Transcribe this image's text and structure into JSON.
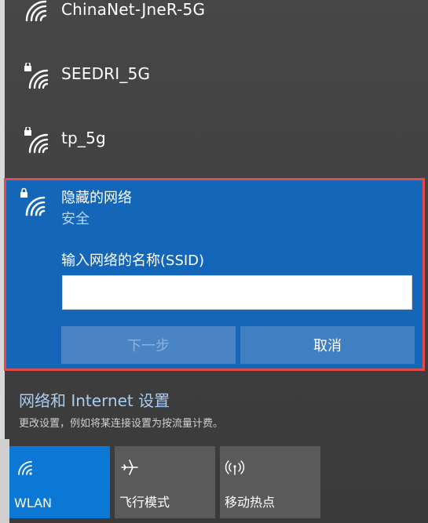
{
  "networks": [
    {
      "name": "ChinaNet-JneR-5G",
      "secured": false
    },
    {
      "name": "SEEDRI_5G",
      "secured": true
    },
    {
      "name": "tp_5g",
      "secured": true
    }
  ],
  "hidden_network": {
    "title": "隐藏的网络",
    "subtitle": "安全",
    "ssid_label": "输入网络的名称(SSID)",
    "ssid_value": "",
    "next_label": "下一步",
    "cancel_label": "取消"
  },
  "settings": {
    "link": "网络和 Internet 设置",
    "description": "更改设置，例如将某连接设置为按流量计费。"
  },
  "quick_actions": [
    {
      "label": "WLAN",
      "icon": "wifi-icon",
      "active": true
    },
    {
      "label": "飞行模式",
      "icon": "airplane-icon",
      "active": false
    },
    {
      "label": "移动热点",
      "icon": "hotspot-icon",
      "active": false
    }
  ],
  "colors": {
    "accent": "#1366b8",
    "highlight_border": "#e24b4b",
    "link": "#a9cdf2",
    "active_tile": "#0a78d4"
  }
}
